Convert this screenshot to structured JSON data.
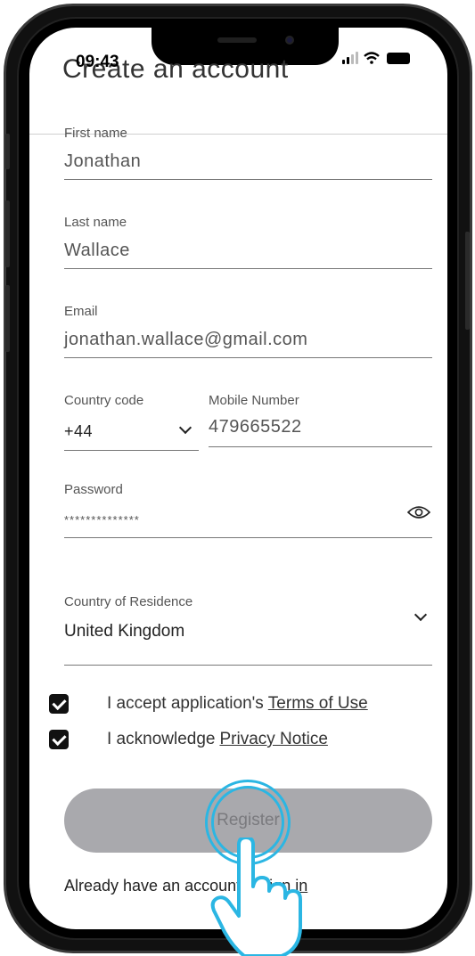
{
  "status_bar": {
    "time": "09:43"
  },
  "page": {
    "title": "Create an account"
  },
  "form": {
    "first_name": {
      "label": "First name",
      "value": "Jonathan"
    },
    "last_name": {
      "label": "Last name",
      "value": "Wallace"
    },
    "email": {
      "label": "Email",
      "value": "jonathan.wallace@gmail.com"
    },
    "country_code": {
      "label": "Country code",
      "value": "+44"
    },
    "mobile": {
      "label": "Mobile Number",
      "value": "479665522"
    },
    "password": {
      "label": "Password",
      "value": "**************"
    },
    "residence": {
      "label": "Country of Residence",
      "value": "United Kingdom"
    }
  },
  "consents": {
    "terms_text": "I accept application's",
    "terms_link": "Terms of Use",
    "privacy_text": "I acknowledge",
    "privacy_link": "Privacy Notice"
  },
  "register_button": {
    "label": "Register"
  },
  "signin": {
    "prompt": "Already have an account?",
    "link": "Sign in"
  },
  "colors": {
    "button_bg": "#a9a9ad",
    "tap_ring": "#2bb6e3",
    "checkbox": "#111111"
  }
}
